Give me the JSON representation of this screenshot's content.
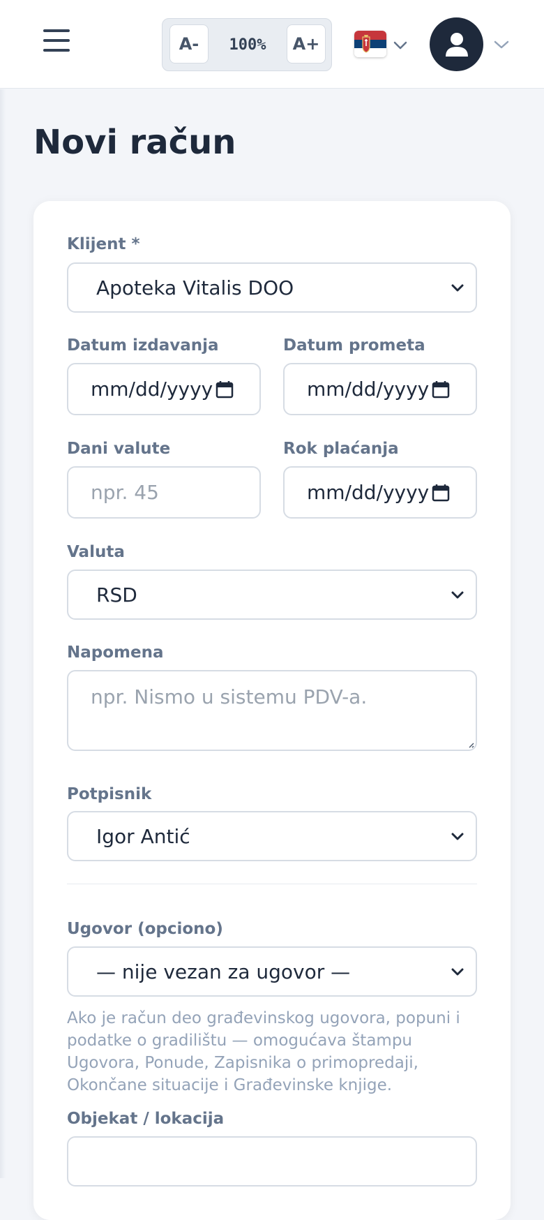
{
  "topbar": {
    "zoom_minus": "A-",
    "zoom_value": "100%",
    "zoom_plus": "A+",
    "language_flag": "serbia-flag"
  },
  "page": {
    "title": "Novi račun"
  },
  "form": {
    "client": {
      "label": "Klijent *",
      "value": "Apoteka Vitalis DOO"
    },
    "issue_date": {
      "label": "Datum izdavanja",
      "value": "mm/dd/yyyy"
    },
    "turnover_date": {
      "label": "Datum prometa",
      "value": "mm/dd/yyyy"
    },
    "value_days": {
      "label": "Dani valute",
      "placeholder": "npr. 45"
    },
    "due_date": {
      "label": "Rok plaćanja",
      "value": "mm/dd/yyyy"
    },
    "currency": {
      "label": "Valuta",
      "value": "RSD"
    },
    "note": {
      "label": "Napomena",
      "placeholder": "npr. Nismo u sistemu PDV-a."
    },
    "signatory": {
      "label": "Potpisnik",
      "value": "Igor Antić"
    },
    "contract": {
      "label": "Ugovor (opciono)",
      "value": "— nije vezan za ugovor —",
      "hint": "Ako je račun deo građevinskog ugovora, popuni i podatke o gradilištu — omogućava štampu Ugovora, Ponude, Zapisnika o primopredaji, Okončane situacije i Građevinske knjige."
    },
    "object_location": {
      "label": "Objekat / lokacija",
      "value": ""
    }
  },
  "colors": {
    "title": "#1e293b",
    "label": "#64748b",
    "border": "#d6dce4",
    "avatar_bg": "#1e293b",
    "page_bg": "#f3f5f9"
  }
}
